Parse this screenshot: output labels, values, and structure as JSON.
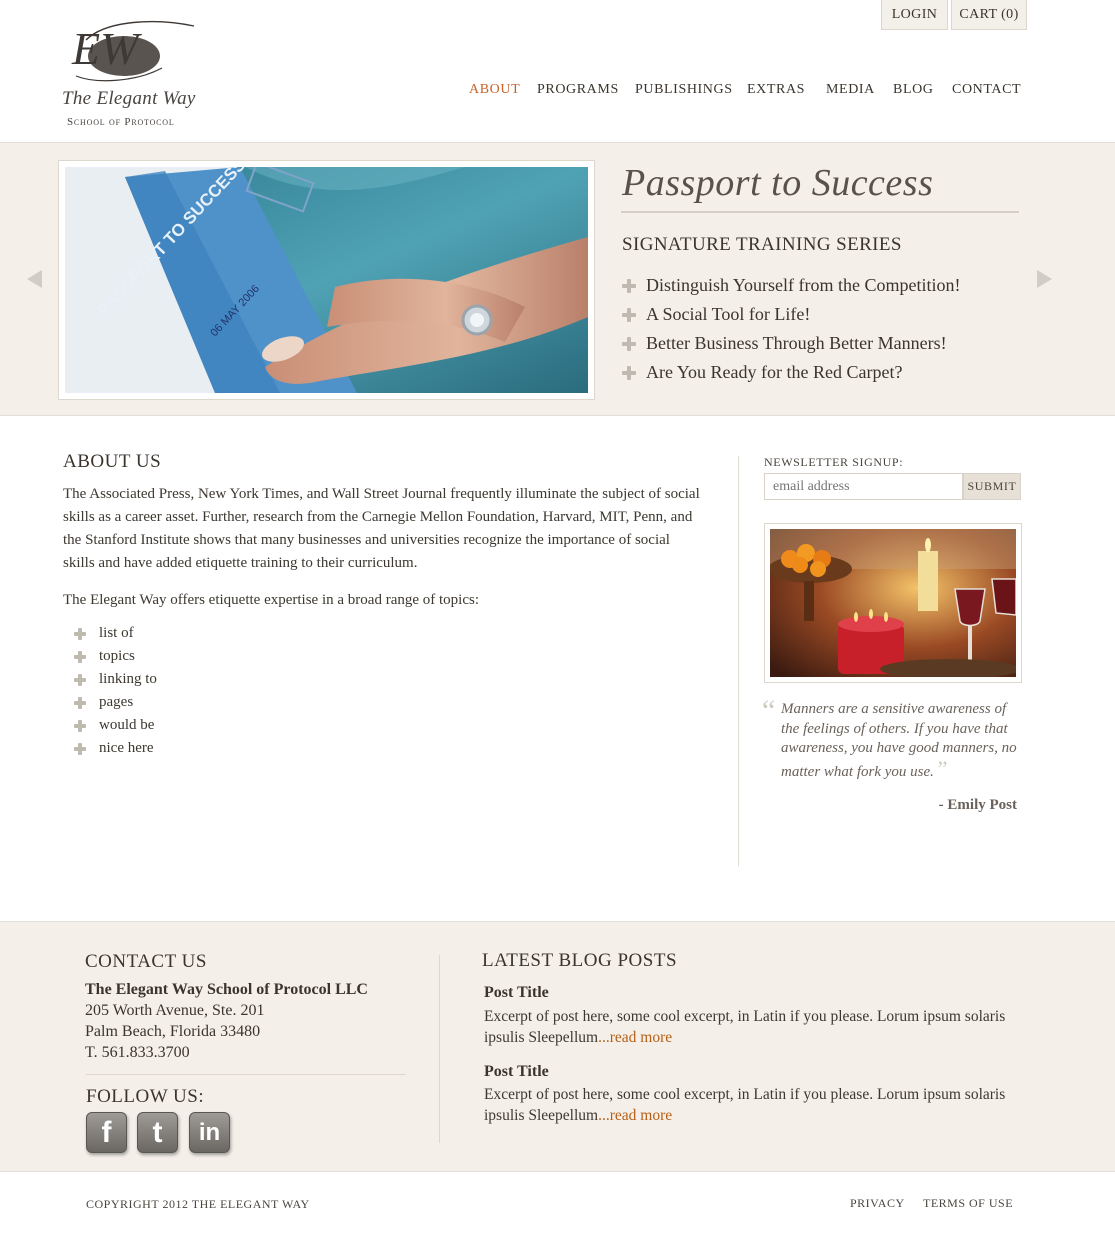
{
  "header": {
    "logo": {
      "monogram": "EW",
      "name": "The Elegant Way",
      "tagline": "School of Protocol"
    },
    "login_label": "LOGIN",
    "cart_label": "CART (0)",
    "nav": [
      {
        "label": "ABOUT",
        "active": true
      },
      {
        "label": "PROGRAMS",
        "active": false
      },
      {
        "label": "PUBLISHINGS",
        "active": false
      },
      {
        "label": "EXTRAS",
        "active": false
      },
      {
        "label": "MEDIA",
        "active": false
      },
      {
        "label": "BLOG",
        "active": false
      },
      {
        "label": "CONTACT",
        "active": false
      }
    ]
  },
  "hero": {
    "title": "Passport to Success",
    "subtitle": "SIGNATURE TRAINING SERIES",
    "bullets": [
      "Distinguish Yourself from the Competition!",
      "A Social Tool for Life!",
      "Better Business Through Better Manners!",
      "Are You Ready for the Red Carpet?"
    ],
    "photo_text": "PASSPORT TO SUCCESS",
    "photo_stamp": "06 MAY 2006"
  },
  "about": {
    "title": "ABOUT US",
    "paragraph1": "The Associated Press, New York Times, and Wall Street Journal frequently illuminate the subject of social skills as a career asset. Further, research from the Carnegie Mellon Foundation, Harvard, MIT, Penn, and the Stanford Institute shows that many businesses and universities recognize the importance of social skills and have added etiquette training to their curriculum.",
    "paragraph2": "The Elegant Way offers etiquette expertise in a broad range of topics:",
    "topics": [
      "list of",
      "topics",
      "linking to",
      "pages",
      "would be",
      "nice here"
    ]
  },
  "sidebar": {
    "newsletter_label": "NEWSLETTER SIGNUP:",
    "email_placeholder": "email address",
    "submit_label": "SUBMIT",
    "quote_open": "“",
    "quote": "Manners are a sensitive awareness of the feelings of others. If you have that awareness, you have good manners, no matter what fork you use.",
    "quote_close": "”",
    "quote_author": "- Emily Post"
  },
  "footer": {
    "contact_title": "CONTACT US",
    "company": "The Elegant Way School of Protocol LLC",
    "address1": "205 Worth Avenue, Ste. 201",
    "address2": "Palm Beach, Florida 33480",
    "phone": "T.  561.833.3700",
    "follow_title": "FOLLOW US:",
    "social": {
      "facebook": "f",
      "twitter": "t",
      "linkedin": "in"
    },
    "blog_title": "LATEST BLOG POSTS",
    "posts": [
      {
        "title": "Post Title",
        "excerpt": "Excerpt of post here, some cool excerpt, in Latin if you please. Lorum ipsum solaris ipsulis Sleepellum",
        "readmore": "...read more"
      },
      {
        "title": "Post Title",
        "excerpt": "Excerpt of post here, some cool excerpt, in Latin if you please. Lorum ipsum solaris ipsulis Sleepellum",
        "readmore": "...read more"
      }
    ],
    "copyright": "COPYRIGHT 2012 THE ELEGANT WAY",
    "privacy_label": "PRIVACY",
    "terms_label": "TERMS OF USE"
  },
  "colors": {
    "accent": "#c4632c",
    "link": "#b55f16",
    "band_background": "#f4f0e9",
    "text": "#3d3830"
  }
}
